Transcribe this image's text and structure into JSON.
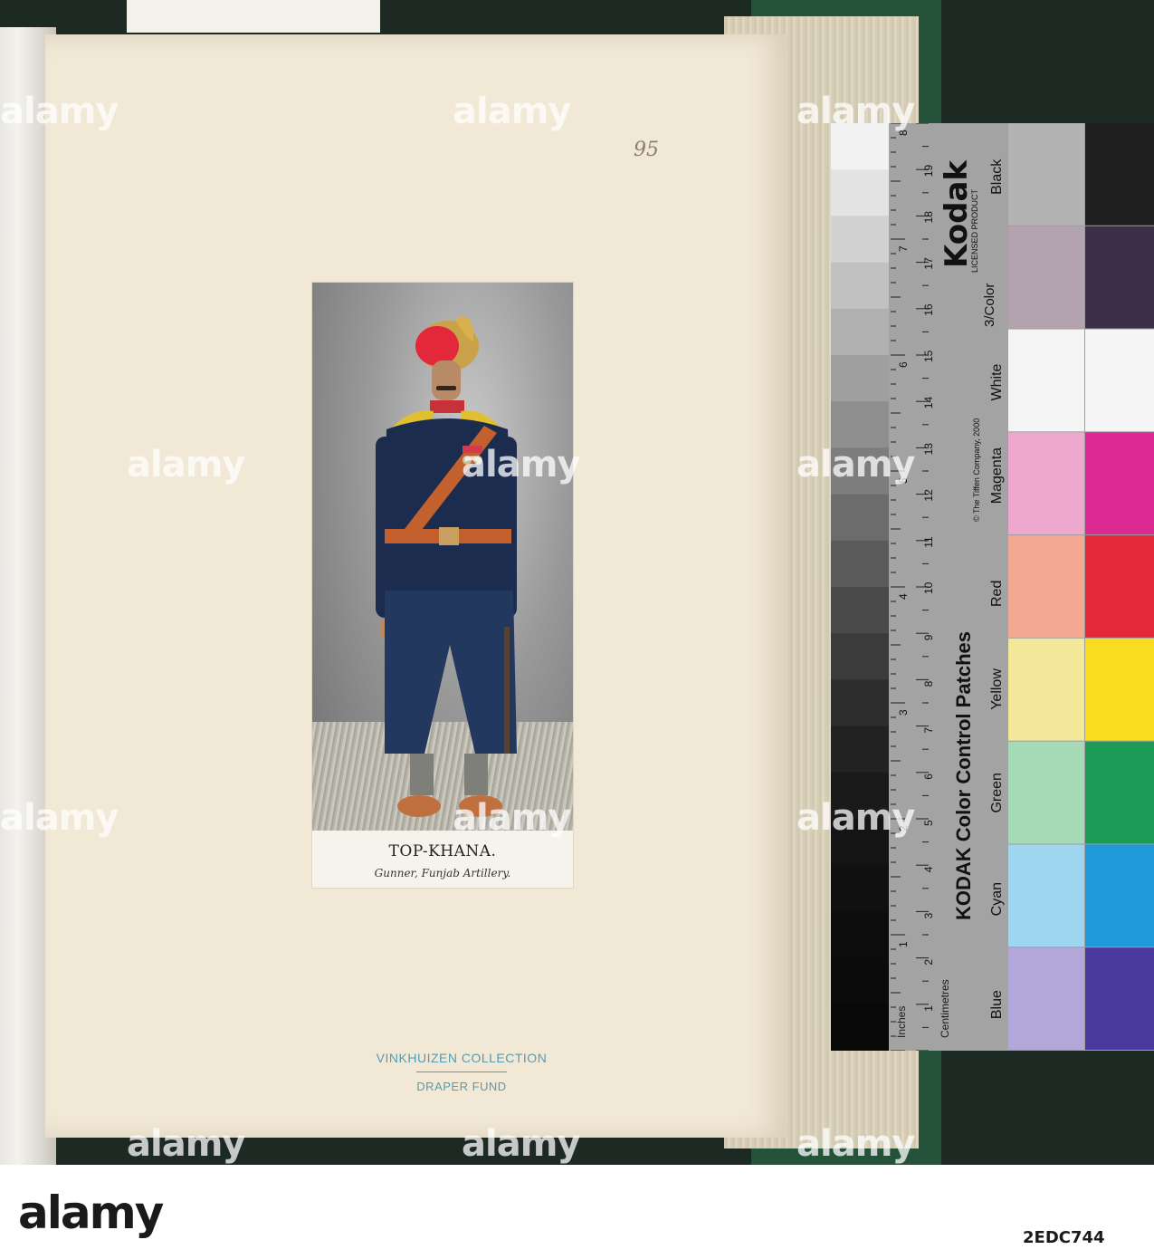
{
  "page": {
    "number_handwritten": "95",
    "caption_title": "TOP-KHANA.",
    "caption_subtitle": "Gunner, Funjab Artillery.",
    "stamp_line1": "VINKHUIZEN COLLECTION",
    "stamp_line2": "DRAPER FUND"
  },
  "color_target": {
    "brand": "Kodak",
    "licensed": "LICENSED PRODUCT",
    "product": "3/Color",
    "title": "KODAK Color Control Patches",
    "copyright": "© The Tiffen Company, 2000",
    "units_inches": "Inches",
    "units_cm": "Centimetres",
    "inch_marks": [
      "1",
      "2",
      "3",
      "4",
      "5",
      "6",
      "7",
      "8"
    ],
    "cm_marks": [
      "1",
      "2",
      "3",
      "4",
      "5",
      "6",
      "7",
      "8",
      "9",
      "10",
      "11",
      "12",
      "13",
      "14",
      "15",
      "16",
      "17",
      "18",
      "19"
    ],
    "patches": [
      {
        "name": "Black",
        "light": "#b3b3b3",
        "dark": "#1f1f1f"
      },
      {
        "name": "3/Color",
        "light": "#b3a3ae",
        "dark": "#3c2f47"
      },
      {
        "name": "White",
        "light": "#f5f5f5",
        "dark": "#f5f5f5"
      },
      {
        "name": "Magenta",
        "light": "#eea7cd",
        "dark": "#db2a91"
      },
      {
        "name": "Red",
        "light": "#f3a894",
        "dark": "#e3283b"
      },
      {
        "name": "Yellow",
        "light": "#f3e79a",
        "dark": "#f7dc1f"
      },
      {
        "name": "Green",
        "light": "#a6d9b5",
        "dark": "#1d9b56"
      },
      {
        "name": "Cyan",
        "light": "#9fd6ef",
        "dark": "#1e9ad8"
      },
      {
        "name": "Blue",
        "light": "#b3a7d9",
        "dark": "#4a3aa0"
      }
    ],
    "gray_steps": [
      "#f2f2f2",
      "#e3e3e3",
      "#d2d2d2",
      "#c1c1c1",
      "#b0b0b0",
      "#9f9f9f",
      "#8e8e8e",
      "#7d7d7d",
      "#6c6c6c",
      "#5b5b5b",
      "#4a4a4a",
      "#3b3b3b",
      "#2d2d2d",
      "#222222",
      "#1a1a1a",
      "#141414",
      "#101010",
      "#0d0d0d",
      "#0b0b0b",
      "#090909"
    ]
  },
  "watermark": {
    "text": "alamy",
    "image_id": "2EDC744"
  }
}
